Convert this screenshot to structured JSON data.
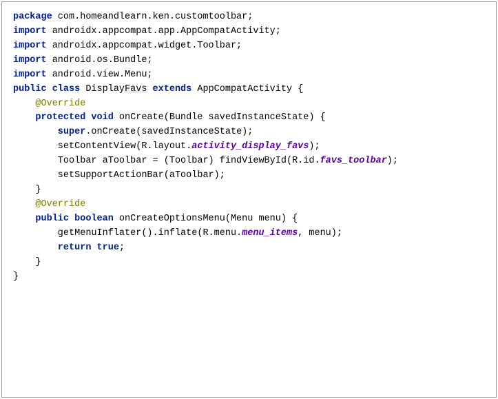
{
  "code": {
    "l1_kw": "package",
    "l1_rest": " com.homeandlearn.ken.customtoolbar;",
    "blank1": "",
    "l2_kw": "import",
    "l2_rest": " androidx.appcompat.app.AppCompatActivity;",
    "l3_kw": "import",
    "l3_rest": " androidx.appcompat.widget.Toolbar;",
    "l4_kw": "import",
    "l4_rest": " android.os.Bundle;",
    "l5_kw": "import",
    "l5_rest": " android.view.Menu;",
    "blank2": "",
    "blank3": "",
    "l6_kw1": "public class",
    "l6_mid": " Display",
    "l6_und": "Favs",
    "l6_sp": " ",
    "l6_kw2": "extends",
    "l6_rest": " AppCompatActivity {",
    "blank4": "",
    "l7_anno": "    @Override",
    "l8_kw": "    protected void",
    "l8_rest": " onCreate(Bundle savedInstanceState) {",
    "l9_kw": "        super",
    "l9_rest": ".onCreate(savedInstanceState);",
    "l10_pre": "        setContentView(R.layout.",
    "l10_it": "activity_display_favs",
    "l10_post": ");",
    "blank5": "",
    "l11_pre": "        Toolbar aToolbar = (Toolbar) findViewById(R.id.",
    "l11_it": "favs_toolbar",
    "l11_post": ");",
    "l12": "        setSupportActionBar(aToolbar);",
    "l13": "    }",
    "blank6": "",
    "l14_anno": "    @Override",
    "l15_kw": "    public boolean",
    "l15_rest": " onCreateOptionsMenu(Menu menu) {",
    "l16_pre": "        getMenuInflater().inflate(R.menu.",
    "l16_it": "menu_items",
    "l16_post": ", menu);",
    "l17_kw": "        return true",
    "l17_rest": ";",
    "l18": "    }",
    "l19": "}"
  }
}
